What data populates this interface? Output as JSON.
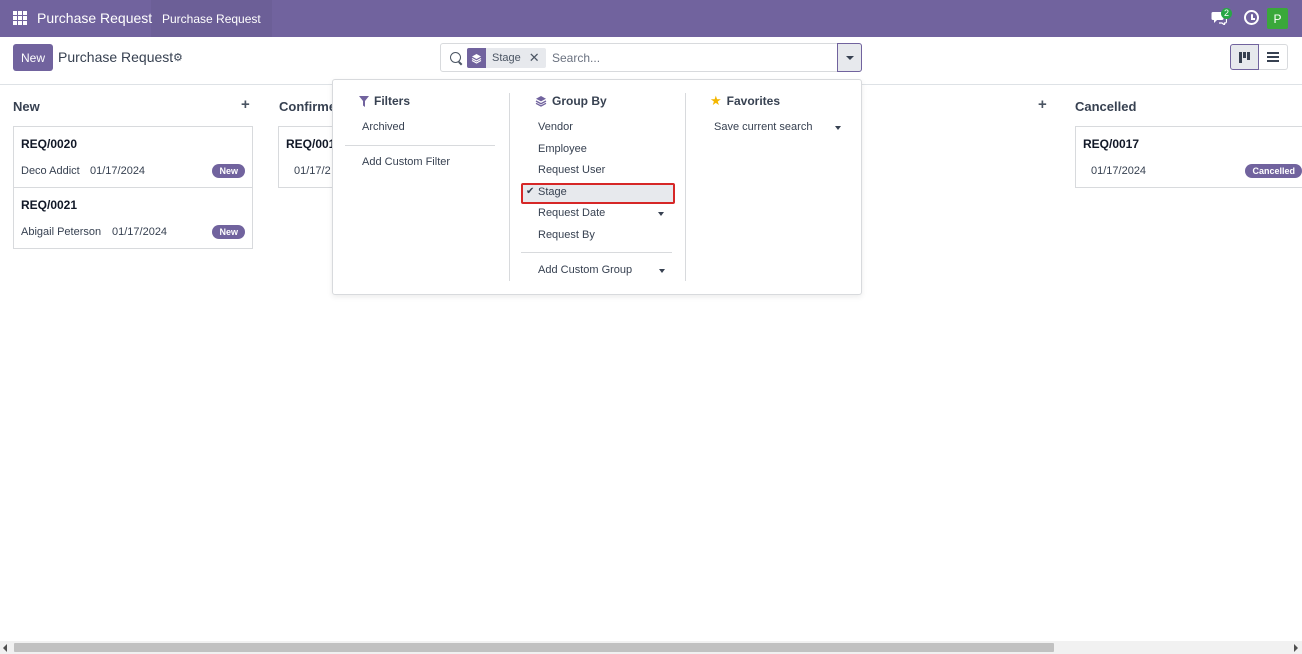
{
  "navbar": {
    "app_name": "Purchase Request",
    "menu_item": "Purchase Request",
    "chat_count": "2",
    "avatar_initial": "P",
    "icons": [
      "apps-icon",
      "chat-icon",
      "clock-icon"
    ],
    "colors": {
      "brand": "#71639e",
      "avatar": "#3aa83a",
      "badge": "#28a745"
    }
  },
  "control_panel": {
    "new_label": "New",
    "title": "Purchase Request",
    "search": {
      "facet_label": "Stage",
      "placeholder": "Search..."
    }
  },
  "kanban": {
    "columns": [
      {
        "title": "New",
        "cards": [
          {
            "ref": "REQ/0020",
            "partner": "Deco Addict",
            "date": "01/17/2024",
            "badge": "New"
          },
          {
            "ref": "REQ/0021",
            "partner": "Abigail Peterson",
            "date": "01/17/2024",
            "badge": "New"
          }
        ]
      },
      {
        "title": "Confirme",
        "cards": [
          {
            "ref": "REQ/001",
            "partner": "",
            "date": "01/17/2"
          }
        ]
      },
      {
        "title": "Cancelled",
        "cards": [
          {
            "ref": "REQ/0017",
            "partner": "",
            "date": "01/17/2024",
            "badge": "Cancelled"
          }
        ]
      }
    ]
  },
  "dropdown": {
    "filters": {
      "heading": "Filters",
      "items": [
        "Archived",
        "Add Custom Filter"
      ]
    },
    "group_by": {
      "heading": "Group By",
      "items": [
        "Vendor",
        "Employee",
        "Request User",
        "Stage",
        "Request Date",
        "Request By"
      ],
      "selected": "Stage",
      "custom": "Add Custom Group"
    },
    "favorites": {
      "heading": "Favorites",
      "items": [
        "Save current search"
      ]
    },
    "highlight_color": "#d62727"
  }
}
